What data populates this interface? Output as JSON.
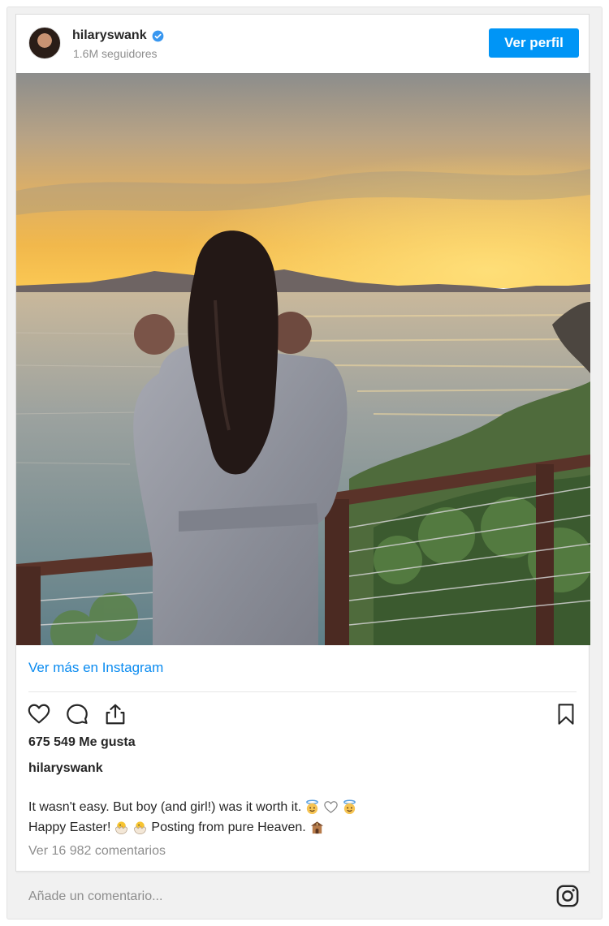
{
  "post": {
    "username": "hilaryswank",
    "followers": "1.6M seguidores",
    "profile_button": "Ver perfil",
    "more_link": "Ver más en Instagram",
    "likes": "675 549 Me gusta",
    "caption_user": "hilaryswank",
    "caption_line1_text": "It wasn't easy. But boy (and girl!) was it worth it.",
    "caption_line2_a": "Happy Easter!",
    "caption_line2_b": "Posting from pure Heaven.",
    "comments_link": "Ver 16 982 comentarios",
    "comment_placeholder": "Añade un comentario..."
  },
  "icons": {
    "verified": "verified-badge-icon",
    "like": "heart-icon",
    "comment": "comment-bubble-icon",
    "share": "share-icon",
    "save": "bookmark-icon",
    "instagram": "instagram-logo-icon",
    "caption_line1_emoji": [
      "angel-face-emoji",
      "white-heart-emoji",
      "angel-face-emoji"
    ],
    "caption_line2_emoji": [
      "hatching-chick-emoji",
      "hatching-chick-emoji",
      "shrine-emoji"
    ]
  },
  "colors": {
    "accent": "#0095f6",
    "link": "#0a8bf0",
    "secondary_text": "#8e8e8e"
  }
}
